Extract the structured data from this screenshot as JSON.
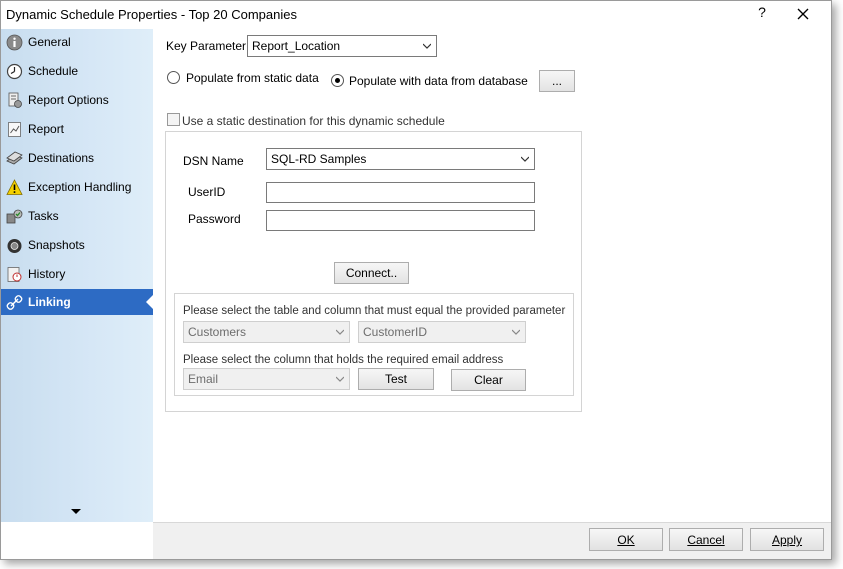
{
  "window": {
    "title": "Dynamic Schedule Properties - Top 20 Companies",
    "help_label": "?"
  },
  "sidebar": {
    "items": [
      {
        "label": "General",
        "icon": "info-icon"
      },
      {
        "label": "Schedule",
        "icon": "clock-icon"
      },
      {
        "label": "Report Options",
        "icon": "report-options-icon"
      },
      {
        "label": "Report",
        "icon": "report-icon"
      },
      {
        "label": "Destinations",
        "icon": "destinations-icon"
      },
      {
        "label": "Exception Handling",
        "icon": "warning-icon"
      },
      {
        "label": "Tasks",
        "icon": "tasks-icon"
      },
      {
        "label": "Snapshots",
        "icon": "camera-icon"
      },
      {
        "label": "History",
        "icon": "history-icon"
      },
      {
        "label": "Linking",
        "icon": "link-icon",
        "active": true
      }
    ],
    "accent_color": "#2d6bc4"
  },
  "main": {
    "key_parameter_label": "Key Parameter",
    "key_parameter_value": "Report_Location",
    "radio_static_label": "Populate from static data",
    "radio_database_label": "Populate with data from database",
    "selected_radio": "database",
    "browse_button_label": "...",
    "static_destination_label": "Use a static destination for this dynamic schedule",
    "static_destination_checked": false,
    "dsn_name_label": "DSN Name",
    "dsn_name_value": "SQL-RD Samples",
    "userid_label": "UserID",
    "userid_value": "",
    "password_label": "Password",
    "password_value": "",
    "connect_button_label": "Connect..",
    "table_column_prompt": "Please select the table and column that must equal the provided parameter",
    "table_value": "Customers",
    "column_value": "CustomerID",
    "email_column_prompt": "Please select the column that holds the required email address",
    "email_column_value": "Email",
    "test_button_label": "Test",
    "clear_button_label": "Clear"
  },
  "footer": {
    "ok_label": "OK",
    "cancel_label": "Cancel",
    "apply_label": "Apply"
  }
}
